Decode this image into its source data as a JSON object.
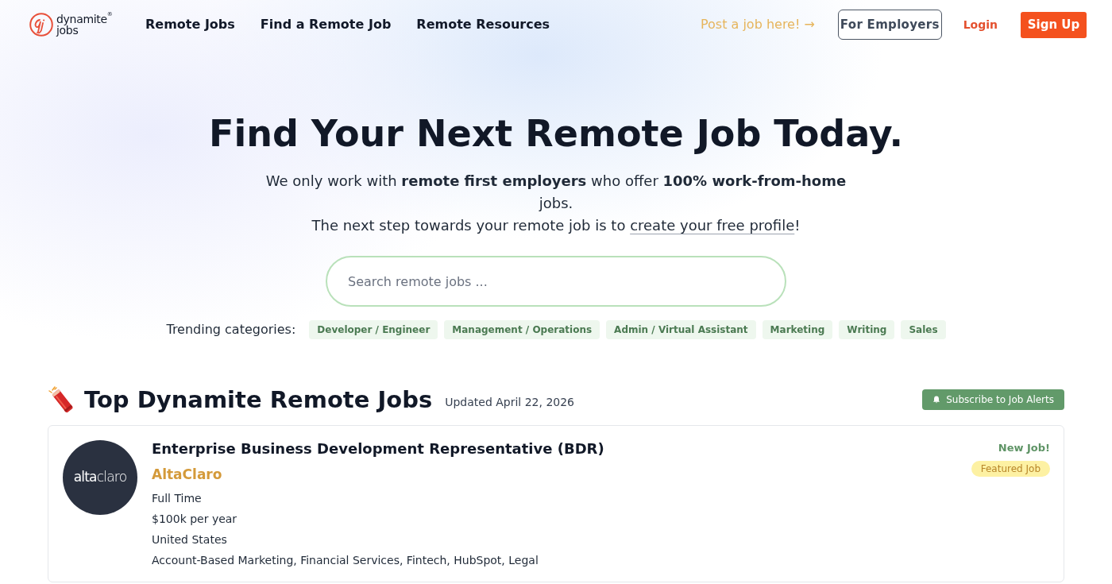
{
  "header": {
    "logo": {
      "top": "dynamite$^{®}$",
      "bottom": "jobs"
    },
    "nav": [
      "Remote Jobs",
      "Find a Remote Job",
      "Remote Resources"
    ],
    "post_job_link": "Post a job here! →",
    "employers_button": "For Employers",
    "login": "Login",
    "signup": "Sign Up"
  },
  "hero": {
    "title": "Find Your Next Remote Job Today.",
    "intro": "We only work with **remote first employers** who offer **100% work-from-home** jobs.",
    "cta": {
      "before": "The next step towards your remote job is to ",
      "link": "create your free profile",
      "after": "!"
    },
    "search": {
      "placeholder": "Search remote jobs ..."
    },
    "trending": {
      "label": "Trending categories:",
      "categories": [
        "Developer / Engineer",
        "Management / Operations",
        "Admin / Virtual Assistant",
        "Marketing",
        "Writing",
        "Sales"
      ]
    }
  },
  "jobs_section": {
    "title": "Top Dynamite Remote Jobs",
    "updated": "Updated April 22, 2026",
    "subscribe_button": "Subscribe to Job Alerts",
    "jobs": [
      {
        "logo_text": "**alta**claro",
        "title": "Enterprise Business Development Representative (BDR)",
        "company": "AltaClaro",
        "details": [
          "Full Time",
          "$100k per year",
          "United States",
          "Account-Based Marketing, Financial Services, Fintech, HubSpot, Legal"
        ],
        "new_label": "New Job!",
        "featured_label": "Featured Job"
      }
    ]
  }
}
